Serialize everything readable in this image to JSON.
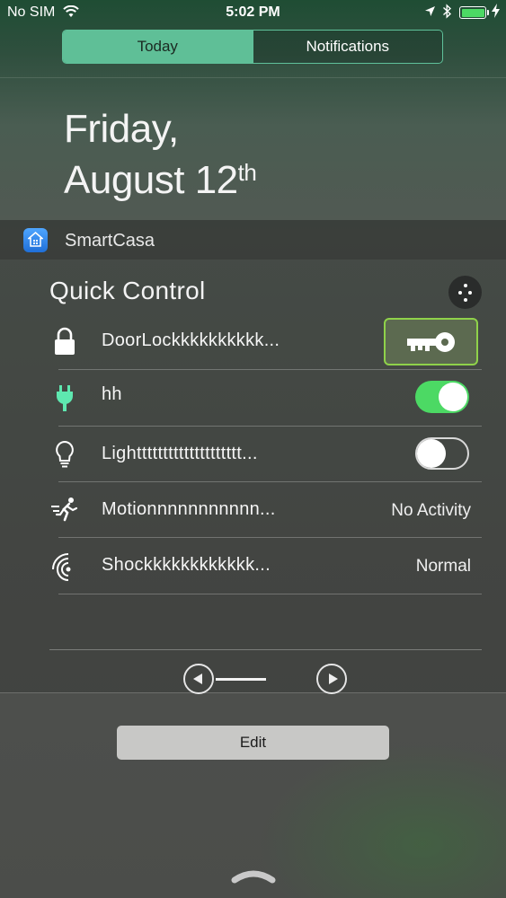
{
  "status_bar": {
    "carrier": "No SIM",
    "time": "5:02 PM",
    "icons": [
      "wifi-icon",
      "location-arrow-icon",
      "bluetooth-icon",
      "battery-icon",
      "charging-bolt-icon"
    ],
    "battery_color": "#4cd964"
  },
  "tabs": [
    {
      "label": "Today",
      "selected": true
    },
    {
      "label": "Notifications",
      "selected": false
    }
  ],
  "date": {
    "weekday": "Friday,",
    "month_day": "August 12",
    "ordinal_suffix": "th"
  },
  "widget": {
    "app_name": "SmartCasa",
    "title": "Quick Control",
    "devices": [
      {
        "name": "DoorLockkkkkkkkkk...",
        "icon": "lock-icon",
        "control": "key-button"
      },
      {
        "name": "hh",
        "icon": "plug-icon",
        "control": "toggle",
        "on": true
      },
      {
        "name": "Lightttttttttttttttttttt...",
        "icon": "bulb-icon",
        "control": "toggle",
        "on": false
      },
      {
        "name": "Motionnnnnnnnnnn...",
        "icon": "motion-icon",
        "control": "status",
        "value": "No Activity"
      },
      {
        "name": "Shockkkkkkkkkkkk...",
        "icon": "shock-icon",
        "control": "status",
        "value": "Normal"
      }
    ]
  },
  "edit_label": "Edit",
  "colors": {
    "accent_tab": "#5fbf97",
    "toggle_on": "#4cd964",
    "key_button_border": "#8fd24a",
    "plug_icon": "#5ee8b0"
  }
}
